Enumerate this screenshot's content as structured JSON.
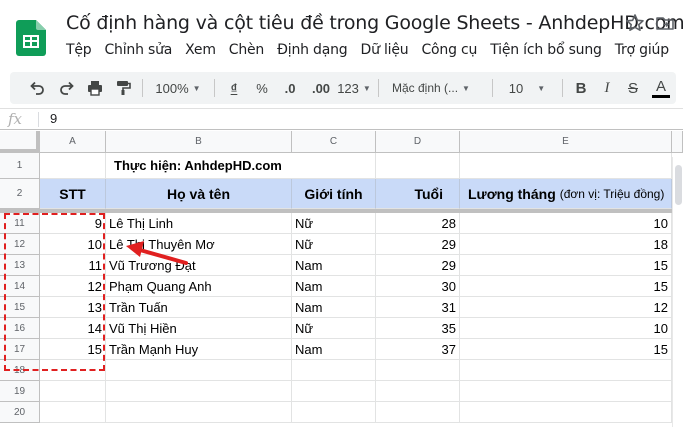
{
  "app": {
    "doc_title": "Cố định hàng và cột tiêu đề trong Google Sheets - AnhdepHD.com",
    "menu": [
      "Tệp",
      "Chỉnh sửa",
      "Xem",
      "Chèn",
      "Định dạng",
      "Dữ liệu",
      "Công cụ",
      "Tiện ích bổ sung",
      "Trợ giúp"
    ]
  },
  "toolbar": {
    "zoom": "100%",
    "currency": "₫",
    "percent": "%",
    "decrease_decimal": ".0",
    "increase_decimal": ".00",
    "more_formats": "123",
    "font": "Mặc định (...",
    "font_size": "10",
    "bold": "B",
    "italic": "I",
    "strikethrough": "S",
    "text_color": "A"
  },
  "formula_bar": {
    "fx": "fx",
    "value": "9"
  },
  "columns": [
    "A",
    "B",
    "C",
    "D",
    "E"
  ],
  "sheet": {
    "title_row": {
      "row": "1",
      "text": "Thực hiện: AnhdepHD.com"
    },
    "header_row": {
      "row": "2",
      "stt": "STT",
      "name": "Họ và tên",
      "gender": "Giới tính",
      "age": "Tuổi",
      "salary": "Lương tháng",
      "salary_unit": "(đơn vị: Triệu đồng)"
    },
    "rows": [
      {
        "row": "11",
        "stt": "9",
        "name": "Lê Thị Linh",
        "gender": "Nữ",
        "age": "28",
        "salary": "10"
      },
      {
        "row": "12",
        "stt": "10",
        "name": "Lê Thị Thuyên Mơ",
        "gender": "Nữ",
        "age": "29",
        "salary": "18"
      },
      {
        "row": "13",
        "stt": "11",
        "name": "Vũ Trương Đạt",
        "gender": "Nam",
        "age": "29",
        "salary": "15"
      },
      {
        "row": "14",
        "stt": "12",
        "name": "Phạm Quang Anh",
        "gender": "Nam",
        "age": "30",
        "salary": "15"
      },
      {
        "row": "15",
        "stt": "13",
        "name": "Trần Tuấn",
        "gender": "Nam",
        "age": "31",
        "salary": "12"
      },
      {
        "row": "16",
        "stt": "14",
        "name": "Vũ Thị Hiền",
        "gender": "Nữ",
        "age": "35",
        "salary": "10"
      },
      {
        "row": "17",
        "stt": "15",
        "name": "Trần Mạnh Huy",
        "gender": "Nam",
        "age": "37",
        "salary": "15"
      }
    ],
    "empty_rows": [
      "18",
      "19",
      "20"
    ]
  },
  "colors": {
    "header_fill": "#c9daf8",
    "annotation": "#e02020",
    "sheets_green": "#0f9d58"
  }
}
